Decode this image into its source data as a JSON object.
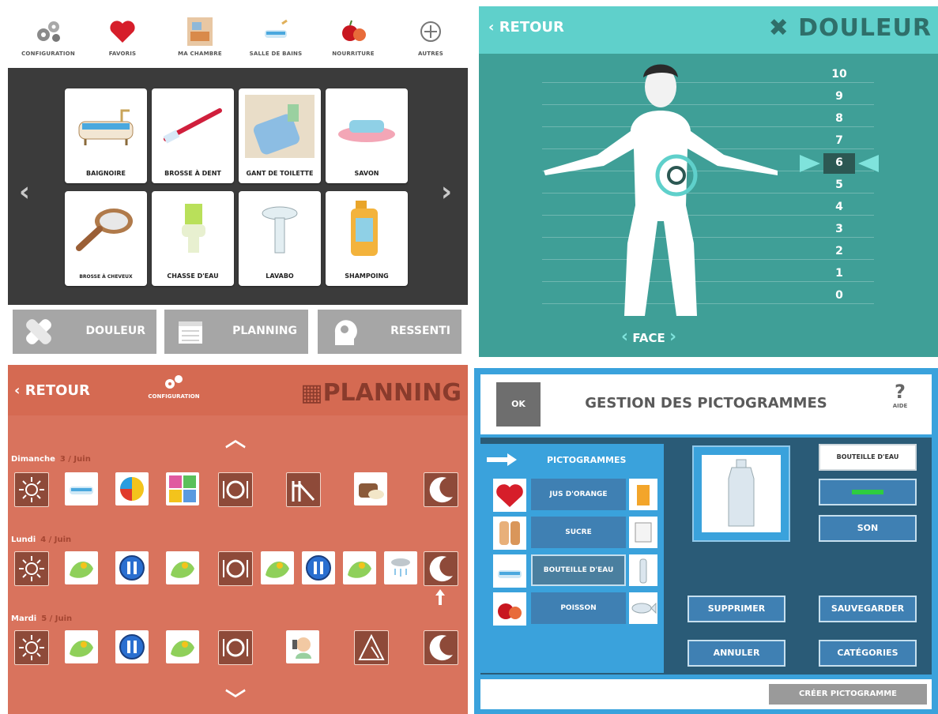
{
  "q1": {
    "categories": [
      {
        "label": "CONFIGURATION",
        "icon": "gears-icon"
      },
      {
        "label": "FAVORIS",
        "icon": "heart-icon"
      },
      {
        "label": "MA CHAMBRE",
        "icon": "bedroom-icon"
      },
      {
        "label": "SALLE DE BAINS",
        "icon": "bathroom-icon"
      },
      {
        "label": "NOURRITURE",
        "icon": "food-icon"
      },
      {
        "label": "AUTRES",
        "icon": "plus-circle-icon"
      }
    ],
    "cards": [
      "BAIGNOIRE",
      "BROSSE À DENT",
      "GANT DE TOILETTE",
      "SAVON",
      "BROSSE À CHEVEUX",
      "CHASSE D'EAU",
      "LAVABO",
      "SHAMPOING"
    ],
    "prev": "‹",
    "next": "›",
    "bottom_buttons": [
      {
        "label": "DOULEUR",
        "icon": "bandage-icon"
      },
      {
        "label": "PLANNING",
        "icon": "calendar-icon"
      },
      {
        "label": "RESSENTI",
        "icon": "head-gears-icon"
      }
    ]
  },
  "q2": {
    "back": "RETOUR",
    "title": "DOULEUR",
    "scale": [
      "10",
      "9",
      "8",
      "7",
      "6",
      "5",
      "4",
      "3",
      "2",
      "1",
      "0"
    ],
    "selected": "6",
    "view": "FACE",
    "colors": {
      "header": "#5fd0cb",
      "background": "#3f9f97",
      "selected": "#2c5853"
    }
  },
  "q3": {
    "back": "RETOUR",
    "config": "CONFIGURATION",
    "title": "PLANNING",
    "days": [
      {
        "name": "Dimanche",
        "date": "3 / Juin"
      },
      {
        "name": "Lundi",
        "date": "4 / Juin"
      },
      {
        "name": "Mardi",
        "date": "5 / Juin"
      }
    ],
    "up": "︿",
    "down": "﹀"
  },
  "q4": {
    "ok": "OK",
    "title": "GESTION DES PICTOGRAMMES",
    "help_mark": "?",
    "help_label": "AIDE",
    "list_title": "PICTOGRAMMES",
    "items": [
      "JUS D'ORANGE",
      "SUCRE",
      "BOUTEILLE D'EAU",
      "POISSON"
    ],
    "selected_name": "BOUTEILLE D'EAU",
    "sound": "SON",
    "delete": "SUPPRIMER",
    "save": "SAUVEGARDER",
    "cancel": "ANNULER",
    "categories": "CATÉGORIES",
    "create": "CRÉER PICTOGRAMME"
  }
}
